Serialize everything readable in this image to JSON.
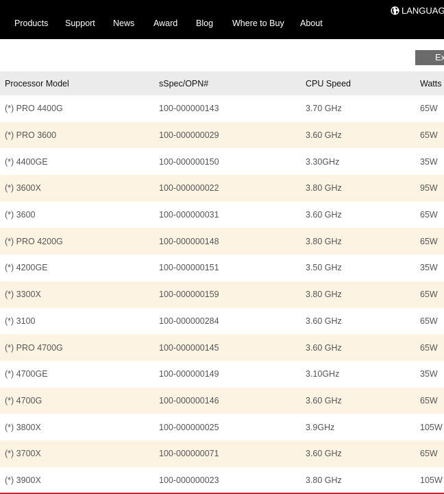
{
  "header": {
    "language_label": "LANGUAGE",
    "nav": [
      "Products",
      "Support",
      "News",
      "Award",
      "Blog",
      "Where to Buy",
      "About"
    ]
  },
  "toolbar": {
    "export_label": "Ex"
  },
  "table": {
    "columns": [
      "Processor Model",
      "sSpec/OPN#",
      "CPU Speed",
      "Watts"
    ],
    "rows": [
      [
        "(*) PRO 4400G",
        "100-000000143",
        "3.70 GHz",
        "65W"
      ],
      [
        "(*) PRO 3600",
        "100-000000029",
        "3.60 GHz",
        "65W"
      ],
      [
        "(*) 4400GE",
        "100-000000150",
        "3.30GHz",
        "35W"
      ],
      [
        "(*) 3600X",
        "100-000000022",
        "3.80 GHz",
        "95W"
      ],
      [
        "(*) 3600",
        "100-000000031",
        "3.60 GHz",
        "65W"
      ],
      [
        "(*) PRO 4200G",
        "100-000000148",
        "3.80 GHz",
        "65W"
      ],
      [
        "(*) 4200GE",
        "100-000000151",
        "3.50 GHz",
        "35W"
      ],
      [
        "(*) 3300X",
        "100-000000159",
        "3.80 GHz",
        "65W"
      ],
      [
        "(*) 3100",
        "100-000000284",
        "3.60 GHz",
        "65W"
      ],
      [
        "(*) PRO 4700G",
        "100-000000145",
        "3.60 GHz",
        "65W"
      ],
      [
        "(*) 4700GE",
        "100-000000149",
        "3.10GHz",
        "35W"
      ],
      [
        "(*) 4700G",
        "100-000000146",
        "3.60 GHz",
        "65W"
      ],
      [
        "(*) 3800X",
        "100-000000025",
        "3.9GHz",
        "105W"
      ],
      [
        "(*) 3700X",
        "100-000000071",
        "3.60 GHz",
        "65W"
      ],
      [
        "(*) 3900X",
        "100-000000023",
        "3.80 GHz",
        "105W"
      ]
    ]
  },
  "icons": {
    "language": "globe-icon"
  },
  "colors": {
    "header_bg": "#000000",
    "table_header_bg": "#ebebeb",
    "row_alt_bg": "#fdf3e2",
    "export_bg": "#6b6b6b",
    "accent_line": "#c6283a"
  }
}
